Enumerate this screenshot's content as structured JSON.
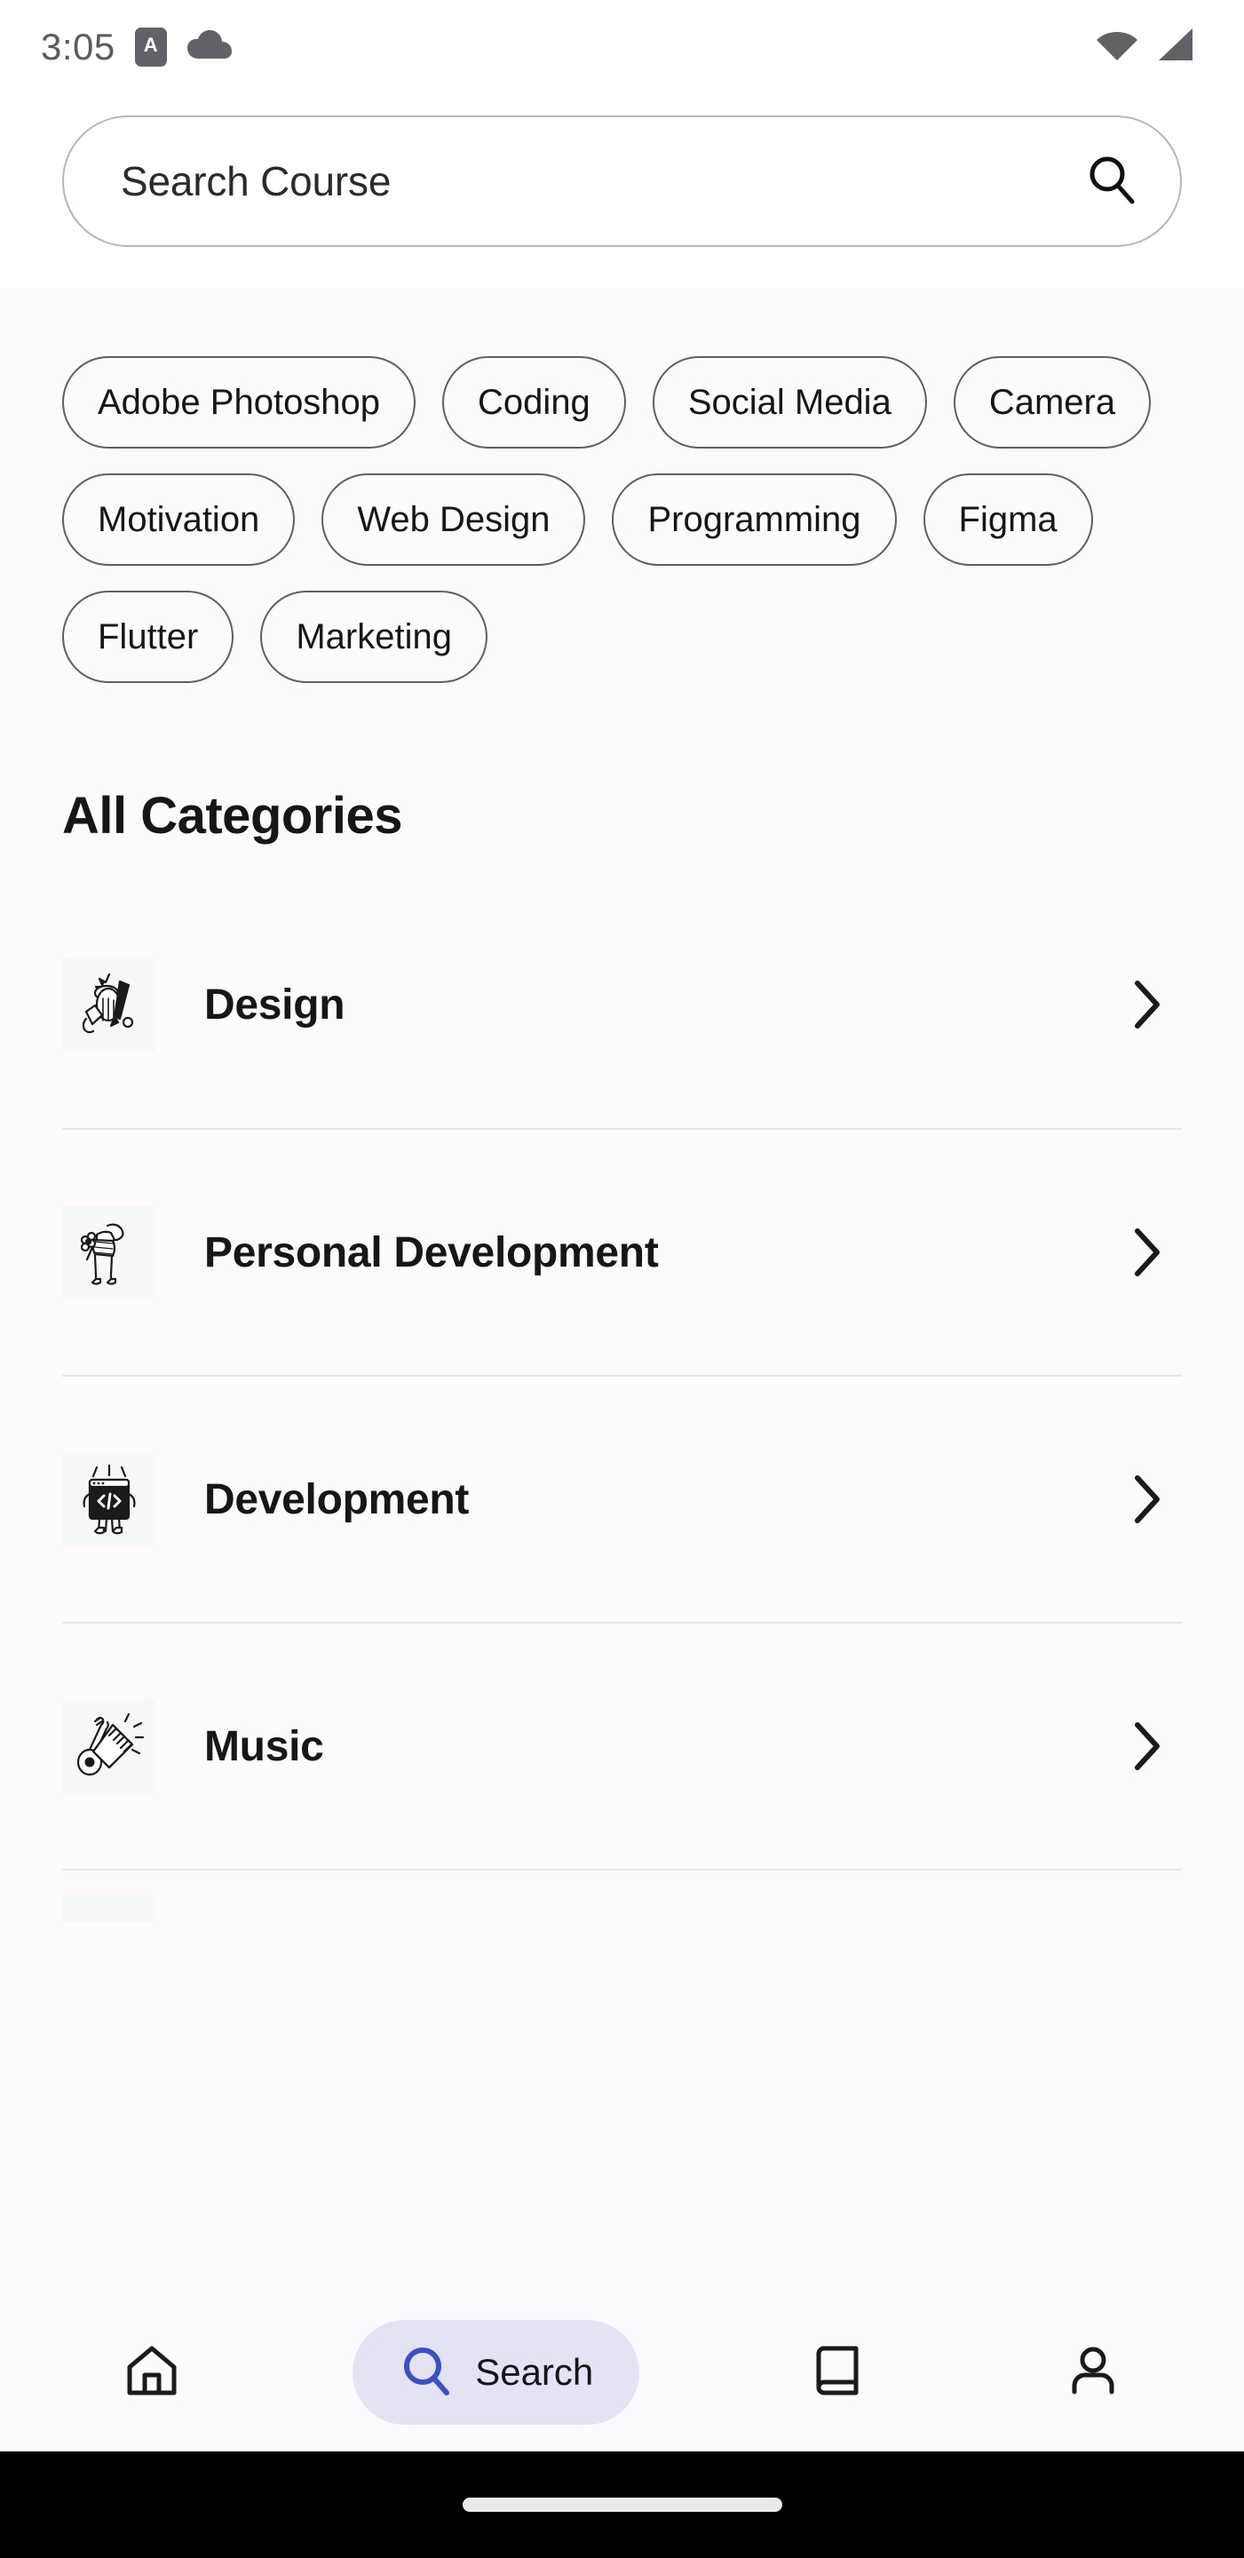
{
  "statusbar": {
    "time": "3:05",
    "app_badge_letter": "A",
    "icons": [
      "app-badge-icon",
      "cloud-icon",
      "wifi-icon",
      "cellular-signal-icon"
    ]
  },
  "search": {
    "placeholder": "Search Course",
    "value": "",
    "icon": "search-icon"
  },
  "chips": [
    {
      "label": "Adobe Photoshop"
    },
    {
      "label": "Coding"
    },
    {
      "label": "Social Media"
    },
    {
      "label": "Camera"
    },
    {
      "label": "Motivation"
    },
    {
      "label": "Web Design"
    },
    {
      "label": "Programming"
    },
    {
      "label": "Figma"
    },
    {
      "label": "Flutter"
    },
    {
      "label": "Marketing"
    }
  ],
  "categories": {
    "title": "All Categories",
    "items": [
      {
        "label": "Design",
        "thumb": "design-doodle-illustration",
        "chevron": "chevron-right-icon"
      },
      {
        "label": "Personal Development",
        "thumb": "person-with-flower-doodle-illustration",
        "chevron": "chevron-right-icon"
      },
      {
        "label": "Development",
        "thumb": "code-window-character-doodle-illustration",
        "chevron": "chevron-right-icon"
      },
      {
        "label": "Music",
        "thumb": "guitar-and-keyboard-doodle-illustration",
        "chevron": "chevron-right-icon"
      }
    ]
  },
  "bottom_nav": {
    "items": [
      {
        "label": "",
        "icon": "home-icon",
        "active": false
      },
      {
        "label": "Search",
        "icon": "search-icon",
        "active": true
      },
      {
        "label": "",
        "icon": "book-icon",
        "active": false
      },
      {
        "label": "",
        "icon": "person-icon",
        "active": false
      }
    ]
  },
  "colors": {
    "page_background": "#fdfaff",
    "header_background": "#ffffff",
    "search_border": "#a9bcc4",
    "chip_border": "#5e5e66",
    "text_primary": "#16161a",
    "divider": "#e4e6ea",
    "active_pill_background": "#e4e3f4",
    "active_accent": "#3d4fc4",
    "thumb_background": "#f4f8f8",
    "status_icon": "#5f6368",
    "system_nav": "#000000"
  }
}
